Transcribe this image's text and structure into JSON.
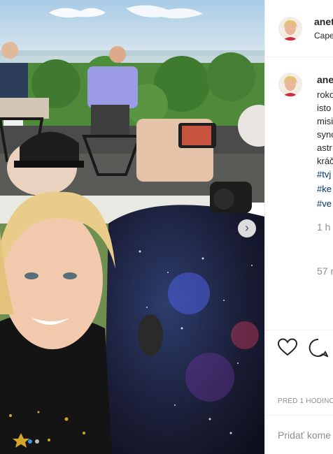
{
  "post": {
    "username": "anet",
    "location": "Cape",
    "caption_lines": [
      "roko",
      "isto",
      "misi",
      "sync",
      "astr",
      "kráč"
    ],
    "hashtags": [
      "#tvj",
      "#ke",
      "#ve"
    ],
    "comment_time": "1 h",
    "likes_partial": "57 r",
    "timestamp": "PRED 1 HODINOU",
    "add_comment_placeholder": "Pridať kome"
  },
  "carousel": {
    "slide": 1,
    "total": 2
  },
  "colors": {
    "accent": "#3897f0",
    "hashtag": "#003569",
    "muted": "#8e8e8e",
    "border": "#efefef"
  }
}
